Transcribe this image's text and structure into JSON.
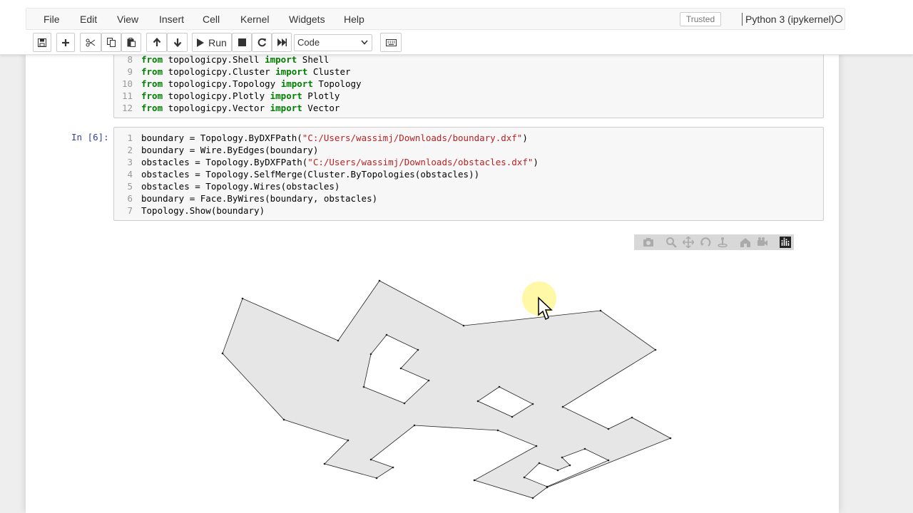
{
  "menu": {
    "items": [
      "File",
      "Edit",
      "View",
      "Insert",
      "Cell",
      "Kernel",
      "Widgets",
      "Help"
    ],
    "trusted": "Trusted",
    "kernel": "Python 3 (ipykernel)"
  },
  "toolbar": {
    "run_label": "Run",
    "cell_type": "Code"
  },
  "cells": [
    {
      "prompt": "",
      "lines": [
        {
          "n": "8",
          "parts": [
            [
              "kw",
              "from"
            ],
            [
              "t",
              " topologicpy.Shell "
            ],
            [
              "kw",
              "import"
            ],
            [
              "t",
              " Shell"
            ]
          ]
        },
        {
          "n": "9",
          "parts": [
            [
              "kw",
              "from"
            ],
            [
              "t",
              " topologicpy.Cluster "
            ],
            [
              "kw",
              "import"
            ],
            [
              "t",
              " Cluster"
            ]
          ]
        },
        {
          "n": "10",
          "parts": [
            [
              "kw",
              "from"
            ],
            [
              "t",
              " topologicpy.Topology "
            ],
            [
              "kw",
              "import"
            ],
            [
              "t",
              " Topology"
            ]
          ]
        },
        {
          "n": "11",
          "parts": [
            [
              "kw",
              "from"
            ],
            [
              "t",
              " topologicpy.Plotly "
            ],
            [
              "kw",
              "import"
            ],
            [
              "t",
              " Plotly"
            ]
          ]
        },
        {
          "n": "12",
          "parts": [
            [
              "kw",
              "from"
            ],
            [
              "t",
              " topologicpy.Vector "
            ],
            [
              "kw",
              "import"
            ],
            [
              "t",
              " Vector"
            ]
          ]
        }
      ]
    },
    {
      "prompt": "In [6]:",
      "lines": [
        {
          "n": "1",
          "parts": [
            [
              "t",
              "boundary = Topology.ByDXFPath("
            ],
            [
              "str",
              "\"C:/Users/wassimj/Downloads/boundary.dxf\""
            ],
            [
              "t",
              ")"
            ]
          ]
        },
        {
          "n": "2",
          "parts": [
            [
              "t",
              "boundary = Wire.ByEdges(boundary)"
            ]
          ]
        },
        {
          "n": "3",
          "parts": [
            [
              "t",
              "obstacles = Topology.ByDXFPath("
            ],
            [
              "str",
              "\"C:/Users/wassimj/Downloads/obstacles.dxf\""
            ],
            [
              "t",
              ")"
            ]
          ]
        },
        {
          "n": "4",
          "parts": [
            [
              "t",
              "obstacles = Topology.SelfMerge(Cluster.ByTopologies(obstacles))"
            ]
          ]
        },
        {
          "n": "5",
          "parts": [
            [
              "t",
              "obstacles = Topology.Wires(obstacles)"
            ]
          ]
        },
        {
          "n": "6",
          "parts": [
            [
              "t",
              "boundary = Face.ByWires(boundary, obstacles)"
            ]
          ]
        },
        {
          "n": "7",
          "parts": [
            [
              "t",
              "Topology.Show(boundary)"
            ]
          ]
        }
      ]
    }
  ],
  "plot": {
    "face_color": "#e6e6e6",
    "edge_color": "#222222",
    "modebar_icons": [
      "camera-icon",
      "zoom-icon",
      "pan-icon",
      "orbit-icon",
      "turntable-icon",
      "home-icon",
      "reset-camera-icon",
      "plotly-logo-icon"
    ]
  }
}
